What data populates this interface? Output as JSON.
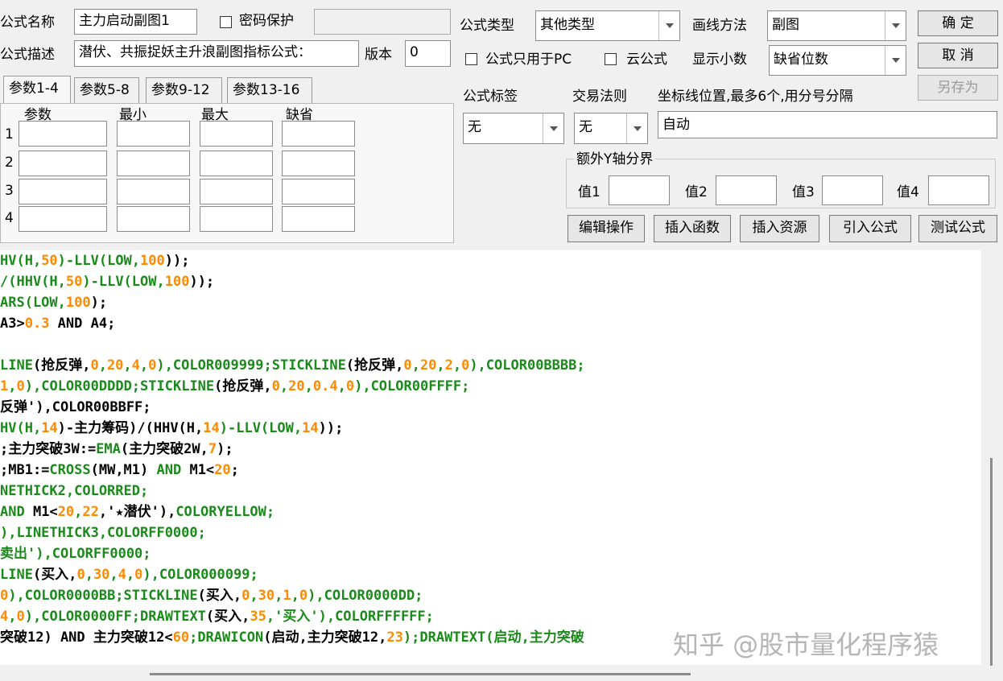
{
  "formula": {
    "name_label": "公式名称",
    "name_value": "主力启动副图1",
    "password_label": "密码保护",
    "desc_label": "公式描述",
    "desc_value": "潜伏、共振捉妖主升浪副图指标公式：",
    "version_label": "版本",
    "version_value": "0",
    "type_label": "公式类型",
    "type_value": "其他类型",
    "draw_label": "画线方法",
    "draw_value": "副图",
    "pc_only_label": "公式只用于PC",
    "cloud_label": "云公式",
    "decimal_label": "显示小数",
    "decimal_value": "缺省位数",
    "tag_label": "公式标签",
    "tag_value": "无",
    "rule_label": "交易法则",
    "rule_value": "无",
    "axis_label": "坐标线位置,最多6个,用分号分隔",
    "axis_value": "自动",
    "extra_y_label": "额外Y轴分界",
    "val1": "值1",
    "val2": "值2",
    "val3": "值3",
    "val4": "值4"
  },
  "buttons": {
    "ok": "确  定",
    "cancel": "取  消",
    "save_as": "另存为",
    "edit_ops": "编辑操作",
    "insert_func": "插入函数",
    "insert_res": "插入资源",
    "import_formula": "引入公式",
    "test_formula": "测试公式"
  },
  "tabs": [
    "参数1-4",
    "参数5-8",
    "参数9-12",
    "参数13-16"
  ],
  "param_headers": [
    "参数",
    "最小",
    "最大",
    "缺省"
  ],
  "param_rows": [
    "1",
    "2",
    "3",
    "4"
  ],
  "code_lines": [
    [
      [
        "HV(H,",
        "g"
      ],
      [
        "50",
        "o"
      ],
      [
        ")-LLV(LOW,",
        "g"
      ],
      [
        "100",
        "o"
      ],
      [
        "));",
        "k"
      ]
    ],
    [
      [
        "/(HHV(H,",
        "g"
      ],
      [
        "50",
        "o"
      ],
      [
        ")-LLV(LOW,",
        "g"
      ],
      [
        "100",
        "o"
      ],
      [
        "));",
        "k"
      ]
    ],
    [
      [
        "ARS(LOW,",
        "g"
      ],
      [
        "100",
        "o"
      ],
      [
        ");",
        "k"
      ]
    ],
    [
      [
        "A3>",
        "k"
      ],
      [
        "0.3",
        "o"
      ],
      [
        " AND A4;",
        "k"
      ]
    ],
    [
      [
        "",
        "k"
      ]
    ],
    [
      [
        "LINE",
        "g"
      ],
      [
        "(抢反弹,",
        "k"
      ],
      [
        "0",
        "o"
      ],
      [
        ",",
        "g"
      ],
      [
        "20",
        "o"
      ],
      [
        ",",
        "g"
      ],
      [
        "4",
        "o"
      ],
      [
        ",",
        "g"
      ],
      [
        "0",
        "o"
      ],
      [
        "),COLOR009999;",
        "g"
      ],
      [
        "STICKLINE",
        "g"
      ],
      [
        "(抢反弹,",
        "k"
      ],
      [
        "0",
        "o"
      ],
      [
        ",",
        "g"
      ],
      [
        "20",
        "o"
      ],
      [
        ",",
        "g"
      ],
      [
        "2",
        "o"
      ],
      [
        ",",
        "g"
      ],
      [
        "0",
        "o"
      ],
      [
        "),COLOR00BBBB;",
        "g"
      ]
    ],
    [
      [
        "1",
        "o"
      ],
      [
        ",",
        "g"
      ],
      [
        "0",
        "o"
      ],
      [
        "),COLOR00DDDD;STICKLINE",
        "g"
      ],
      [
        "(抢反弹,",
        "k"
      ],
      [
        "0",
        "o"
      ],
      [
        ",",
        "g"
      ],
      [
        "20",
        "o"
      ],
      [
        ",",
        "g"
      ],
      [
        "0.4",
        "o"
      ],
      [
        ",",
        "g"
      ],
      [
        "0",
        "o"
      ],
      [
        "),COLOR00FFFF;",
        "g"
      ]
    ],
    [
      [
        "反弹'),COLOR00BBFF;",
        "k"
      ]
    ],
    [
      [
        "HV(H,",
        "g"
      ],
      [
        "14",
        "o"
      ],
      [
        ")-主力筹码)/(HHV(H,",
        "k"
      ],
      [
        "14",
        "o"
      ],
      [
        ")-LLV(LOW,",
        "g"
      ],
      [
        "14",
        "o"
      ],
      [
        "));",
        "k"
      ]
    ],
    [
      [
        ";主力突破3W:=",
        "k"
      ],
      [
        "EMA",
        "g"
      ],
      [
        "(主力突破2W,",
        "k"
      ],
      [
        "7",
        "o"
      ],
      [
        ");",
        "k"
      ]
    ],
    [
      [
        ";MB1:=",
        "k"
      ],
      [
        "CROSS",
        "g"
      ],
      [
        "(MW,M1) ",
        "k"
      ],
      [
        "AND",
        "g"
      ],
      [
        " M1<",
        "k"
      ],
      [
        "20",
        "o"
      ],
      [
        ";",
        "k"
      ]
    ],
    [
      [
        "NETHICK2,COLORRED;",
        "g"
      ]
    ],
    [
      [
        "AND",
        "g"
      ],
      [
        " M1<",
        "k"
      ],
      [
        "20",
        "o"
      ],
      [
        ",",
        "g"
      ],
      [
        "22",
        "o"
      ],
      [
        ",'★潜伏'),",
        "k"
      ],
      [
        "COLORYELLOW;",
        "g"
      ]
    ],
    [
      [
        "),LINETHICK3,COLORFF0000;",
        "g"
      ]
    ],
    [
      [
        "卖出'),COLORFF0000;",
        "g"
      ]
    ],
    [
      [
        "LINE",
        "g"
      ],
      [
        "(买入,",
        "k"
      ],
      [
        "0",
        "o"
      ],
      [
        ",",
        "g"
      ],
      [
        "30",
        "o"
      ],
      [
        ",",
        "g"
      ],
      [
        "4",
        "o"
      ],
      [
        ",",
        "g"
      ],
      [
        "0",
        "o"
      ],
      [
        "),COLOR000099;",
        "g"
      ]
    ],
    [
      [
        "0",
        "o"
      ],
      [
        "),COLOR0000BB;STICKLINE",
        "g"
      ],
      [
        "(买入,",
        "k"
      ],
      [
        "0",
        "o"
      ],
      [
        ",",
        "g"
      ],
      [
        "30",
        "o"
      ],
      [
        ",",
        "g"
      ],
      [
        "1",
        "o"
      ],
      [
        ",",
        "g"
      ],
      [
        "0",
        "o"
      ],
      [
        "),COLOR0000DD;",
        "g"
      ]
    ],
    [
      [
        "4",
        "o"
      ],
      [
        ",",
        "g"
      ],
      [
        "0",
        "o"
      ],
      [
        "),COLOR0000FF;DRAWTEXT",
        "g"
      ],
      [
        "(买入,",
        "k"
      ],
      [
        "35",
        "o"
      ],
      [
        ",'买入'),COLORFFFFFF;",
        "g"
      ]
    ],
    [
      [
        "突破12) AND 主力突破12<",
        "k"
      ],
      [
        "60",
        "o"
      ],
      [
        ";DRAWICON",
        "g"
      ],
      [
        "(启动,主力突破12,",
        "k"
      ],
      [
        "23",
        "o"
      ],
      [
        ");DRAWTEXT(启动,主力突破",
        "g"
      ]
    ]
  ],
  "watermark": "知乎 @股市量化程序猿"
}
